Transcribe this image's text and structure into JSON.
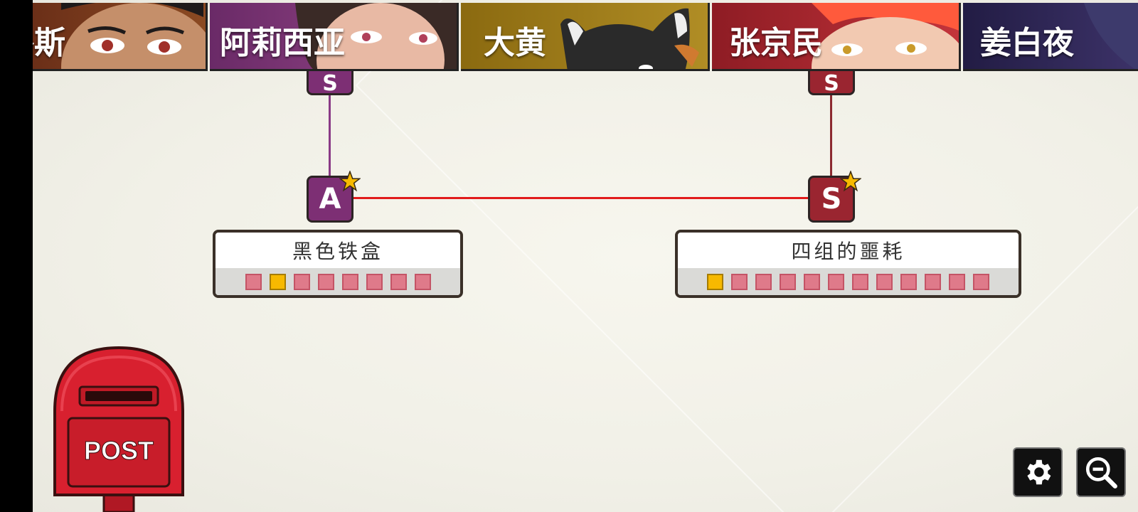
{
  "characters": [
    {
      "name": "洛斯",
      "color": "#7a3a1e"
    },
    {
      "name": "阿莉西亚",
      "color": "#7d2f74"
    },
    {
      "name": "大黄",
      "color": "#9b7a14"
    },
    {
      "name": "张京民",
      "color": "#a3222a"
    },
    {
      "name": "姜白夜",
      "color": "#2c2650"
    }
  ],
  "graph": {
    "line_colors": {
      "alicia": "#8a3a86",
      "zhang": "#8c2a30",
      "link": "#e11b1b"
    },
    "nodes": [
      {
        "id": "alicia-top",
        "grade": "S",
        "color": "#7d2f74"
      },
      {
        "id": "zhang-top",
        "grade": "S",
        "color": "#9a2530"
      },
      {
        "id": "alicia-main",
        "grade": "A",
        "color": "#7d2f74",
        "starred": true
      },
      {
        "id": "zhang-main",
        "grade": "S",
        "color": "#9a2530",
        "starred": true
      }
    ],
    "cards": [
      {
        "title": "黑色铁盒",
        "slots": [
          0,
          1,
          0,
          0,
          0,
          0,
          0,
          0
        ]
      },
      {
        "title": "四组的噩耗",
        "slots": [
          1,
          0,
          0,
          0,
          0,
          0,
          0,
          0,
          0,
          0,
          0,
          0
        ]
      }
    ]
  },
  "postbox": {
    "label": "POST",
    "color": "#d8202f"
  },
  "controls": {
    "settings_icon": "gear-icon",
    "zoom_icon": "zoom-out-icon"
  }
}
